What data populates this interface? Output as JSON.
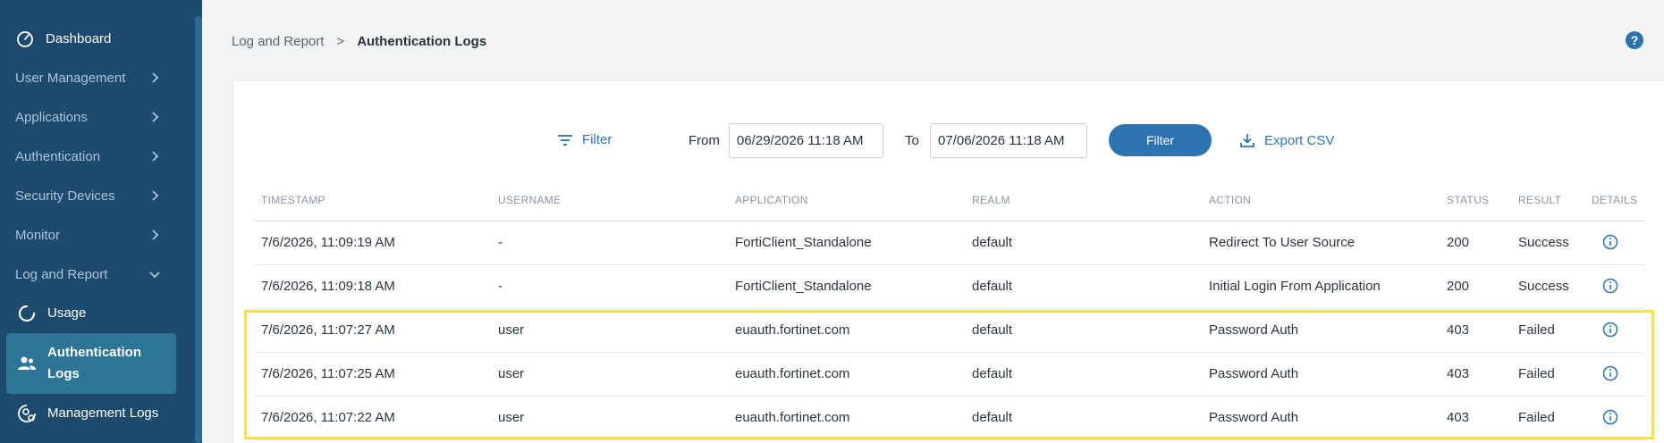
{
  "sidebar": {
    "items": [
      {
        "label": "Dashboard",
        "icon": "dashboard-icon"
      },
      {
        "label": "User Management"
      },
      {
        "label": "Applications"
      },
      {
        "label": "Authentication"
      },
      {
        "label": "Security Devices"
      },
      {
        "label": "Monitor"
      },
      {
        "label": "Log and Report"
      }
    ],
    "sub_items": [
      {
        "label": "Usage",
        "icon": "usage-icon"
      },
      {
        "label": "Authentication Logs",
        "icon": "users-icon"
      },
      {
        "label": "Management Logs",
        "icon": "gear-user-icon"
      }
    ]
  },
  "breadcrumb": {
    "parent": "Log and Report",
    "separator": ">",
    "current": "Authentication Logs"
  },
  "help": {
    "label": "?"
  },
  "toolbar": {
    "filter_label": "Filter",
    "from_label": "From",
    "from_value": "06/29/2026 11:18 AM",
    "to_label": "To",
    "to_value": "07/06/2026 11:18 AM",
    "filter_button": "Filter",
    "export_label": "Export CSV"
  },
  "table": {
    "headers": [
      "TIMESTAMP",
      "USERNAME",
      "APPLICATION",
      "REALM",
      "ACTION",
      "STATUS",
      "RESULT",
      "DETAILS"
    ],
    "rows": [
      [
        "7/6/2026, 11:09:19 AM",
        "-",
        "FortiClient_Standalone",
        "default",
        "Redirect To User Source",
        "200",
        "Success"
      ],
      [
        "7/6/2026, 11:09:18 AM",
        "-",
        "FortiClient_Standalone",
        "default",
        "Initial Login From Application",
        "200",
        "Success"
      ],
      [
        "7/6/2026, 11:07:27 AM",
        "user",
        "euauth.fortinet.com",
        "default",
        "Password Auth",
        "403",
        "Failed"
      ],
      [
        "7/6/2026, 11:07:25 AM",
        "user",
        "euauth.fortinet.com",
        "default",
        "Password Auth",
        "403",
        "Failed"
      ],
      [
        "7/6/2026, 11:07:22 AM",
        "user",
        "euauth.fortinet.com",
        "default",
        "Password Auth",
        "403",
        "Failed"
      ]
    ]
  },
  "colors": {
    "sidebar_bg": "#1e4a6d",
    "accent": "#2d73b0",
    "active_item": "#2b7596",
    "highlight": "#f7ea16"
  }
}
